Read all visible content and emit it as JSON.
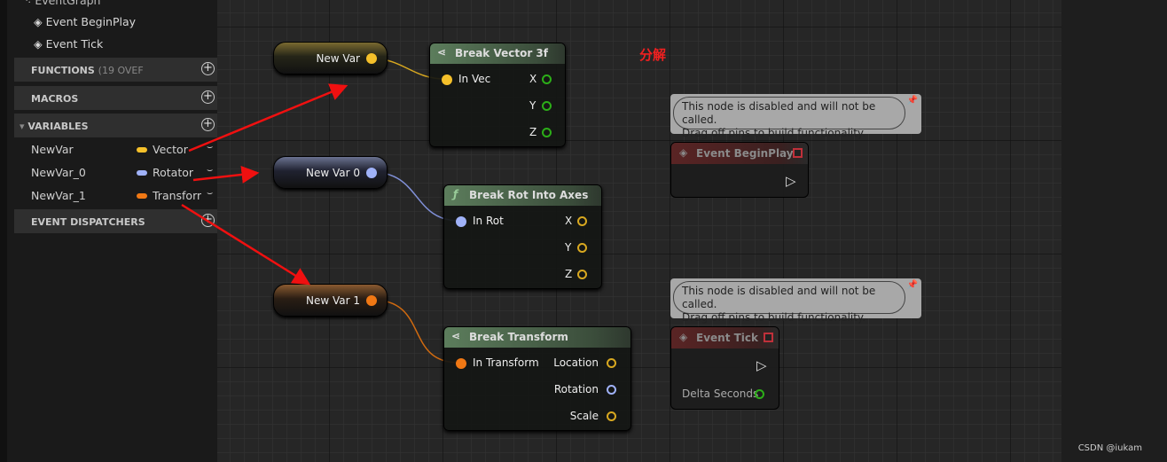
{
  "sidebar": {
    "graph_label": "EventGraph",
    "events": [
      "Event BeginPlay",
      "Event Tick"
    ],
    "sections": {
      "functions": "FUNCTIONS",
      "functions_count": "(19 OVEF",
      "macros": "MACROS",
      "variables": "VARIABLES",
      "dispatchers": "EVENT DISPATCHERS"
    },
    "variables": [
      {
        "name": "NewVar",
        "type": "Vector",
        "color": "#f5c02a"
      },
      {
        "name": "NewVar_0",
        "type": "Rotator",
        "color": "#a0b2f8"
      },
      {
        "name": "NewVar_1",
        "type": "Transform",
        "color": "#f07814"
      }
    ]
  },
  "graph": {
    "annotation": "分解",
    "var_nodes": [
      "New Var",
      "New Var 0",
      "New Var 1"
    ],
    "break_vector": {
      "title": "Break Vector 3f",
      "input": "In Vec",
      "outputs": [
        "X",
        "Y",
        "Z"
      ]
    },
    "break_rot": {
      "title": "Break Rot Into Axes",
      "input": "In Rot",
      "outputs": [
        "X",
        "Y",
        "Z"
      ]
    },
    "break_transform": {
      "title": "Break Transform",
      "input": "In Transform",
      "outputs": [
        "Location",
        "Rotation",
        "Scale"
      ]
    },
    "comment_text": [
      "This node is disabled and will not be called.",
      "Drag off pins to build functionality."
    ],
    "event_beginplay": "Event BeginPlay",
    "event_tick": "Event Tick",
    "delta_seconds": "Delta Seconds"
  },
  "watermark": "CSDN @iukam"
}
